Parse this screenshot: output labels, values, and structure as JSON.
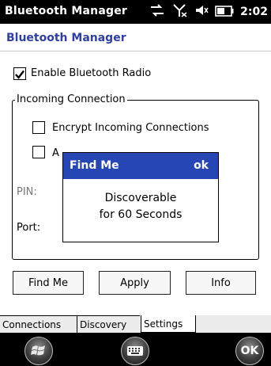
{
  "titlebar": {
    "title": "Bluetooth Manager",
    "time": "2:02"
  },
  "header": {
    "title": "Bluetooth Manager"
  },
  "enable_radio": {
    "label": "Enable Bluetooth Radio",
    "checked": true
  },
  "incoming": {
    "legend": "Incoming Connection",
    "encrypt": {
      "label": "Encrypt Incoming Connections",
      "checked": false
    },
    "auth": {
      "label": "A",
      "checked": false
    },
    "pin_label": "PIN:",
    "port_label": "Port:"
  },
  "buttons": {
    "find_me": "Find Me",
    "apply": "Apply",
    "info": "Info"
  },
  "popup": {
    "title": "Find Me",
    "ok": "ok",
    "line1": "Discoverable",
    "line2": "for 60 Seconds"
  },
  "tabs": [
    {
      "label": "Connections",
      "active": false
    },
    {
      "label": "Discovery",
      "active": false
    },
    {
      "label": "Settings",
      "active": true
    }
  ],
  "softkeys": {
    "ok": "OK"
  },
  "colors": {
    "accent": "#2546b4",
    "header_text": "#2f3fa6"
  }
}
